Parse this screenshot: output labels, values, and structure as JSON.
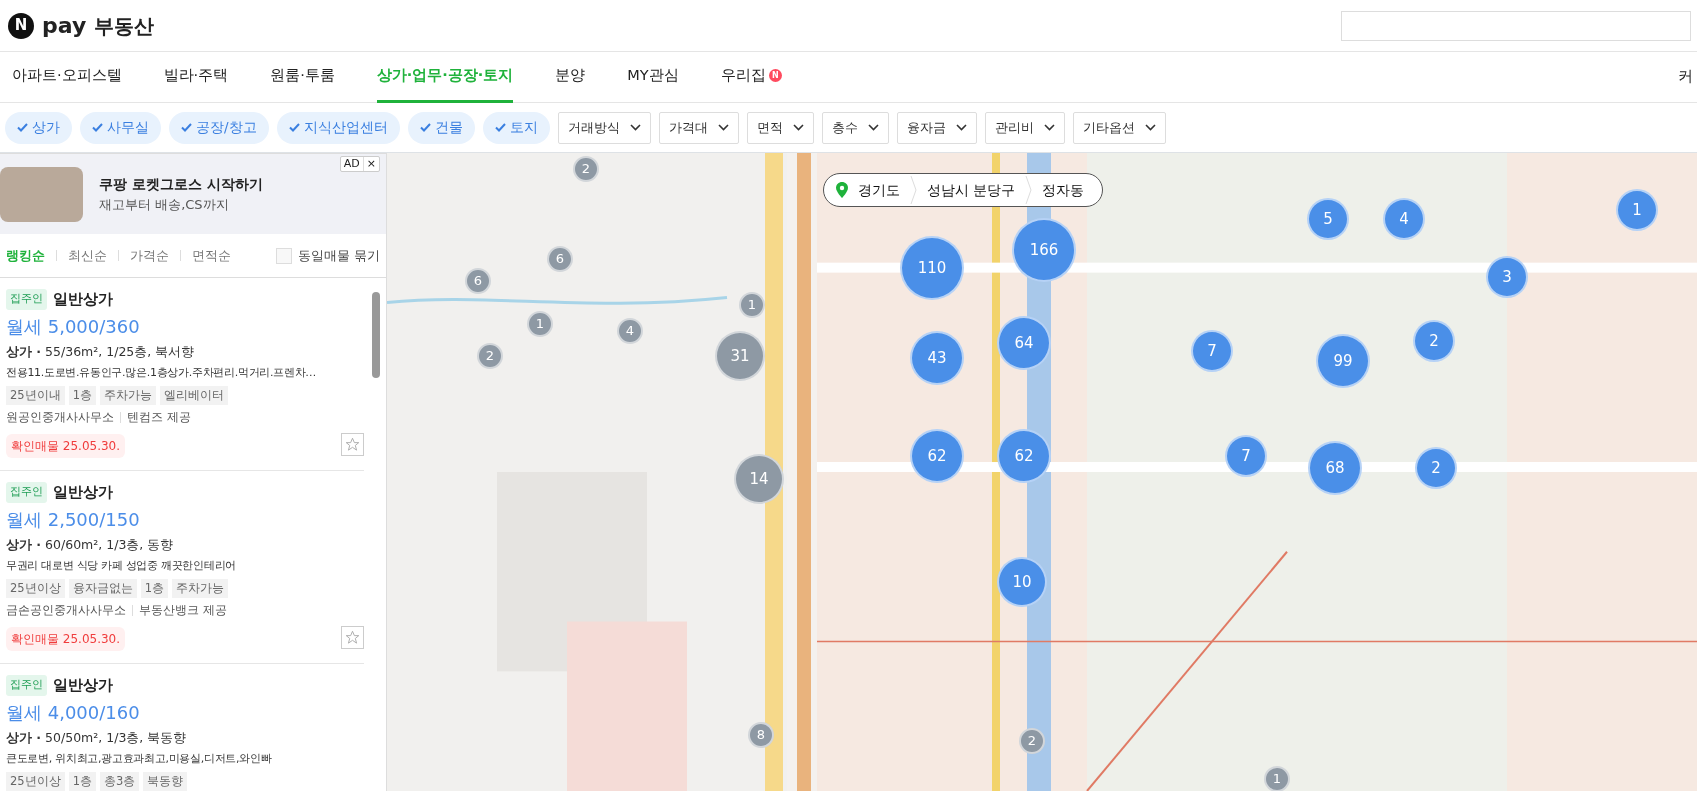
{
  "header": {
    "logo_badge": "N",
    "logo_pay": "pay",
    "logo_title": "부동산"
  },
  "nav_tabs": [
    {
      "label": "아파트·오피스텔",
      "selected": false
    },
    {
      "label": "빌라·주택",
      "selected": false
    },
    {
      "label": "원룸·투룸",
      "selected": false
    },
    {
      "label": "상가·업무·공장·토지",
      "selected": true
    },
    {
      "label": "분양",
      "selected": false
    },
    {
      "label": "MY관심",
      "selected": false
    },
    {
      "label": "우리집",
      "selected": false,
      "badge": "N"
    }
  ],
  "nav_right": "커",
  "filter_chips": [
    {
      "label": "상가",
      "checked": true
    },
    {
      "label": "사무실",
      "checked": true
    },
    {
      "label": "공장/창고",
      "checked": true
    },
    {
      "label": "지식산업센터",
      "checked": true
    },
    {
      "label": "건물",
      "checked": true
    },
    {
      "label": "토지",
      "checked": true
    }
  ],
  "filter_dropdowns": [
    "거래방식",
    "가격대",
    "면적",
    "층수",
    "융자금",
    "관리비",
    "기타옵션"
  ],
  "ad": {
    "title": "쿠팡 로켓그로스 시작하기",
    "subtitle": "재고부터 배송,CS까지",
    "label": "AD",
    "close": "×"
  },
  "sort_options": [
    {
      "label": "랭킹순",
      "selected": true
    },
    {
      "label": "최신순",
      "selected": false
    },
    {
      "label": "가격순",
      "selected": false
    },
    {
      "label": "면적순",
      "selected": false
    }
  ],
  "group_same": {
    "label": "동일매물 묶기",
    "checked": false
  },
  "listings": [
    {
      "owner_tag": "집주인",
      "type": "일반상가",
      "price": "월세 5,000/360",
      "spec": "**상가 ·** 55/36m², 1/25층, 북서향",
      "description": "전용11.도로변.유동인구.많은.1층상가.주차편리.먹거리.프렌차…",
      "tags": [
        "25년이내",
        "1층",
        "주차가능",
        "엘리베이터"
      ],
      "agent": "원공인중개사사무소",
      "source": "텐컴즈 제공",
      "confirmed": "확인매물 25.05.30."
    },
    {
      "owner_tag": "집주인",
      "type": "일반상가",
      "price": "월세 2,500/150",
      "spec": "**상가 ·** 60/60m², 1/3층, 동향",
      "description": "무권리 대로변 식당 카페 성업중 깨끗한인테리어",
      "tags": [
        "25년이상",
        "융자금없는",
        "1층",
        "주차가능"
      ],
      "agent": "금손공인중개사사무소",
      "source": "부동산뱅크 제공",
      "confirmed": "확인매물 25.05.30."
    },
    {
      "owner_tag": "집주인",
      "type": "일반상가",
      "price": "월세 4,000/160",
      "spec": "**상가 ·** 50/50m², 1/3층, 북동향",
      "description": "큰도로변, 위치최고,광고효과최고,미용실,디저트,와인빠",
      "tags": [
        "25년이상",
        "1층",
        "총3층",
        "북동향"
      ]
    }
  ],
  "breadcrumb": [
    "경기도",
    "성남시 분당구",
    "정자동"
  ],
  "map_markers": [
    {
      "count": "2",
      "color": "#8e99a4"
    },
    {
      "count": "6",
      "color": "#8e99a4"
    },
    {
      "count": "6",
      "color": "#8e99a4"
    },
    {
      "count": "1",
      "color": "#8e99a4"
    },
    {
      "count": "4",
      "color": "#8e99a4"
    },
    {
      "count": "2",
      "color": "#8e99a4"
    },
    {
      "count": "1",
      "color": "#8e99a4"
    },
    {
      "count": "31",
      "color": "#8e99a4"
    },
    {
      "count": "14",
      "color": "#8e99a4"
    },
    {
      "count": "8",
      "color": "#8e99a4"
    },
    {
      "count": "2",
      "color": "#8e99a4"
    },
    {
      "count": "1",
      "color": "#8e99a4"
    },
    {
      "count": "110",
      "color": "#4a8fe8"
    },
    {
      "count": "166",
      "color": "#4a8fe8"
    },
    {
      "count": "5",
      "color": "#4a8fe8"
    },
    {
      "count": "4",
      "color": "#4a8fe8"
    },
    {
      "count": "1",
      "color": "#4a8fe8"
    },
    {
      "count": "3",
      "color": "#4a8fe8"
    },
    {
      "count": "43",
      "color": "#4a8fe8"
    },
    {
      "count": "64",
      "color": "#4a8fe8"
    },
    {
      "count": "7",
      "color": "#4a8fe8"
    },
    {
      "count": "99",
      "color": "#4a8fe8"
    },
    {
      "count": "2",
      "color": "#4a8fe8"
    },
    {
      "count": "62",
      "color": "#4a8fe8"
    },
    {
      "count": "62",
      "color": "#4a8fe8"
    },
    {
      "count": "7",
      "color": "#4a8fe8"
    },
    {
      "count": "68",
      "color": "#4a8fe8"
    },
    {
      "count": "2",
      "color": "#4a8fe8"
    },
    {
      "count": "10",
      "color": "#4a8fe8"
    }
  ]
}
